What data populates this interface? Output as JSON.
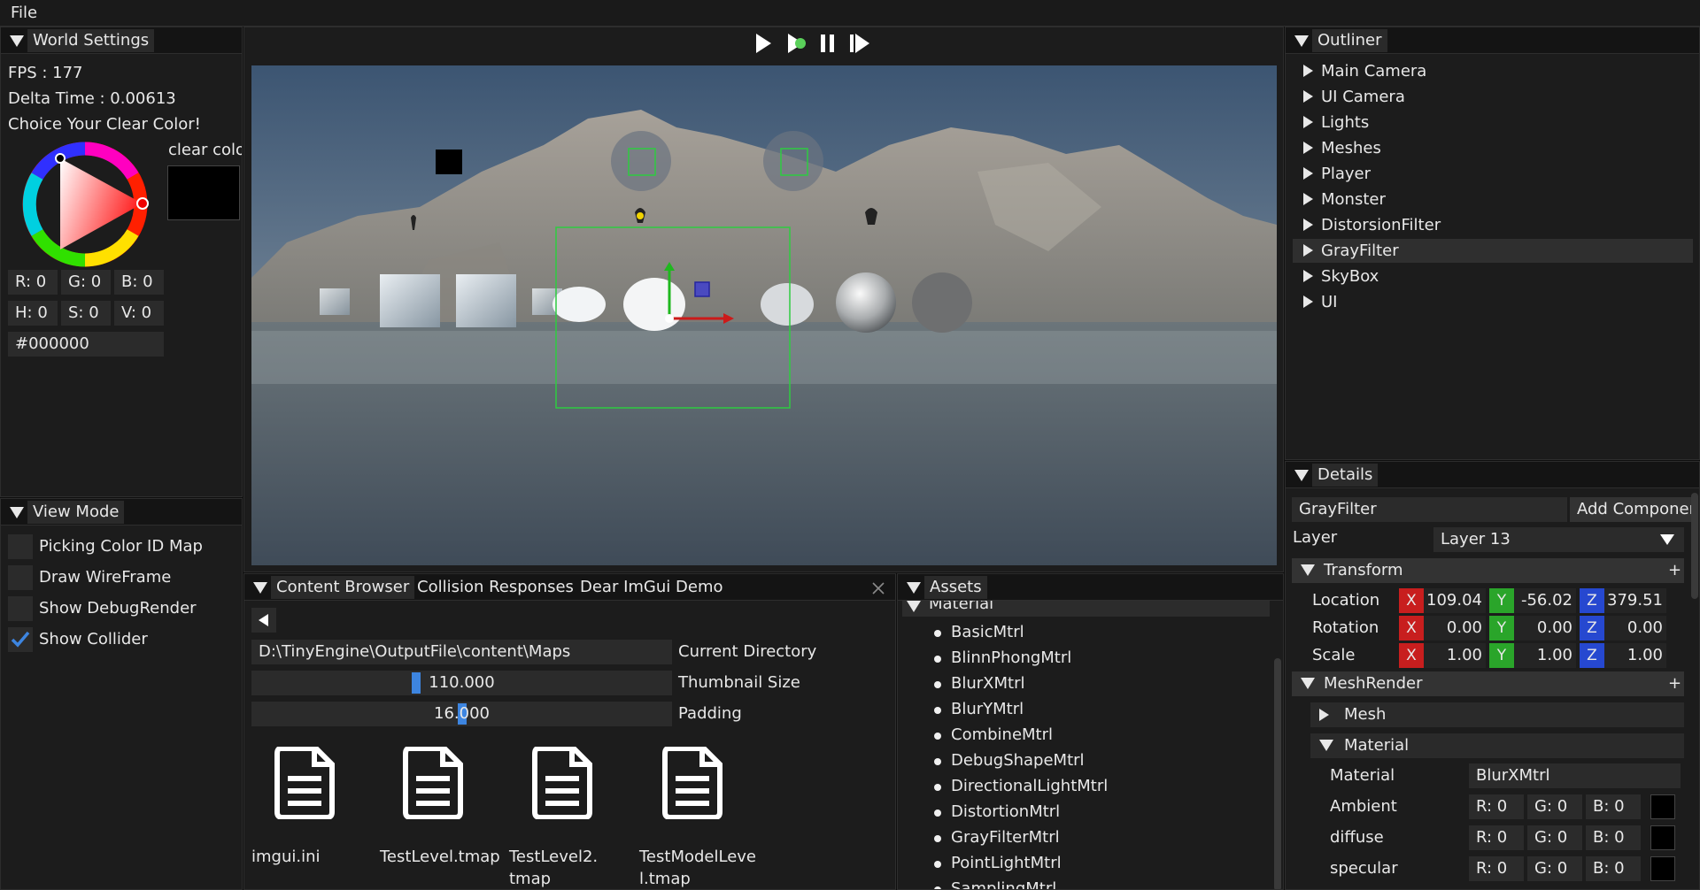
{
  "menubar": {
    "file": "File"
  },
  "world_settings": {
    "title": "World Settings",
    "fps": "FPS : 177",
    "delta": "Delta Time : 0.00613",
    "choice": "Choice Your Clear Color!",
    "clear_label": "clear colo",
    "r": "R: 0",
    "g": "G: 0",
    "b": "B: 0",
    "h": "H: 0",
    "s": "S: 0",
    "v": "V: 0",
    "hex": "#000000"
  },
  "view_mode": {
    "title": "View Mode",
    "options": [
      {
        "label": "Picking Color ID Map",
        "checked": false
      },
      {
        "label": "Draw WireFrame",
        "checked": false
      },
      {
        "label": "Show DebugRender",
        "checked": false
      },
      {
        "label": "Show Collider",
        "checked": true
      }
    ]
  },
  "content_browser": {
    "tabs": [
      "Content Browser",
      "Collision Responses",
      "Dear ImGui Demo"
    ],
    "directory": "D:\\TinyEngine\\OutputFile\\content\\Maps",
    "directory_label": "Current Directory",
    "thumbnail_value": "110.000",
    "thumbnail_label": "Thumbnail Size",
    "thumbnail_fraction": 0.39,
    "padding_value": "16.000",
    "padding_label": "Padding",
    "padding_fraction": 0.5,
    "files": [
      {
        "line1": "imgui.ini",
        "line2": ""
      },
      {
        "line1": "TestLevel.tmap",
        "line2": ""
      },
      {
        "line1": "TestLevel2.",
        "line2": "tmap"
      },
      {
        "line1": "TestModelLeve",
        "line2": "l.tmap"
      }
    ]
  },
  "assets": {
    "title": "Assets",
    "folder": "Material",
    "items": [
      "BasicMtrl",
      "BlinnPhongMtrl",
      "BlurXMtrl",
      "BlurYMtrl",
      "CombineMtrl",
      "DebugShapeMtrl",
      "DirectionalLightMtrl",
      "DistortionMtrl",
      "GrayFilterMtrl",
      "PointLightMtrl",
      "SamplingMtrl"
    ]
  },
  "outliner": {
    "title": "Outliner",
    "items": [
      "Main Camera",
      "UI Camera",
      "Lights",
      "Meshes",
      "Player",
      "Monster",
      "DistorsionFilter",
      "GrayFilter",
      "SkyBox",
      "UI"
    ],
    "selected_index": 7
  },
  "details": {
    "title": "Details",
    "name": "GrayFilter",
    "add_component": "Add Componen",
    "layer_label": "Layer",
    "layer_value": "Layer 13",
    "transform": "Transform",
    "plus": "+",
    "rows": [
      {
        "label": "Location",
        "x": "109.04",
        "y": "-56.02",
        "z": "379.51"
      },
      {
        "label": "Rotation",
        "x": "0.00",
        "y": "0.00",
        "z": "0.00"
      },
      {
        "label": "Scale",
        "x": "1.00",
        "y": "1.00",
        "z": "1.00"
      }
    ],
    "axes": {
      "x": "X",
      "y": "Y",
      "z": "Z"
    },
    "mesh_render": "MeshRender",
    "mesh": "Mesh",
    "material_section": "Material",
    "material_label": "Material",
    "material_value": "BlurXMtrl",
    "colors": [
      {
        "label": "Ambient",
        "r": "R: 0",
        "g": "G: 0",
        "b": "B: 0"
      },
      {
        "label": "diffuse",
        "r": "R: 0",
        "g": "G: 0",
        "b": "B: 0"
      },
      {
        "label": "specular",
        "r": "R: 0",
        "g": "G: 0",
        "b": "B: 0"
      }
    ]
  },
  "colors": {
    "x_red": "#c81e1e",
    "y_green": "#2aa52a",
    "z_blue": "#2648d0",
    "accent": "#3d85e0"
  }
}
